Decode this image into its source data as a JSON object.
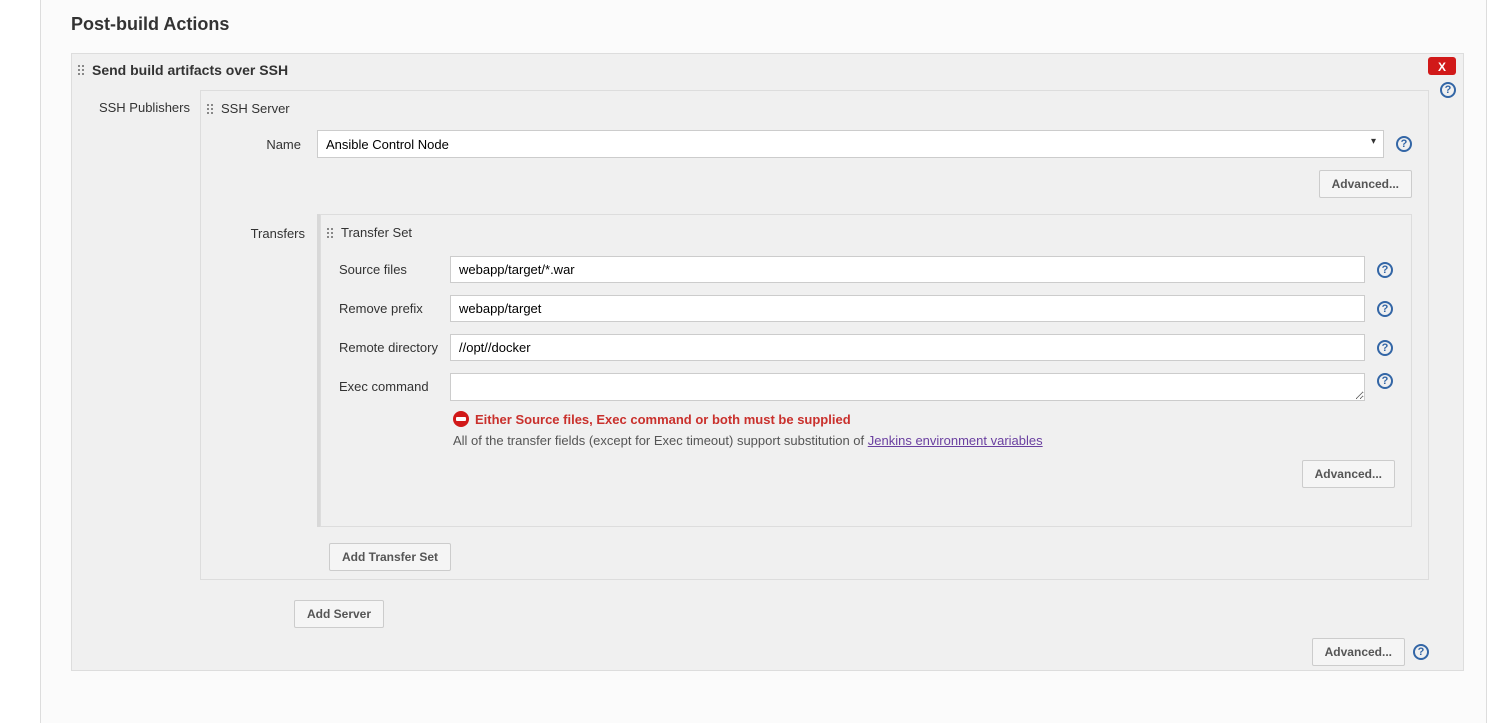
{
  "page": {
    "heading": "Post-build Actions"
  },
  "action": {
    "title": "Send build artifacts over SSH",
    "close_label": "X"
  },
  "labels": {
    "ssh_publishers": "SSH Publishers",
    "ssh_server": "SSH Server",
    "name": "Name",
    "advanced": "Advanced...",
    "transfers": "Transfers",
    "transfer_set": "Transfer Set",
    "source_files": "Source files",
    "remove_prefix": "Remove prefix",
    "remote_directory": "Remote directory",
    "exec_command": "Exec command",
    "add_transfer_set": "Add Transfer Set",
    "add_server": "Add Server"
  },
  "ssh_server": {
    "selected": "Ansible Control Node"
  },
  "transfer": {
    "source_files": "webapp/target/*.war",
    "remove_prefix": "webapp/target",
    "remote_directory": "//opt//docker",
    "exec_command": ""
  },
  "validation": {
    "message": "Either Source files, Exec command or both must be supplied"
  },
  "hint": {
    "prefix": "All of the transfer fields (except for Exec timeout) support substitution of ",
    "link_text": "Jenkins environment variables"
  }
}
